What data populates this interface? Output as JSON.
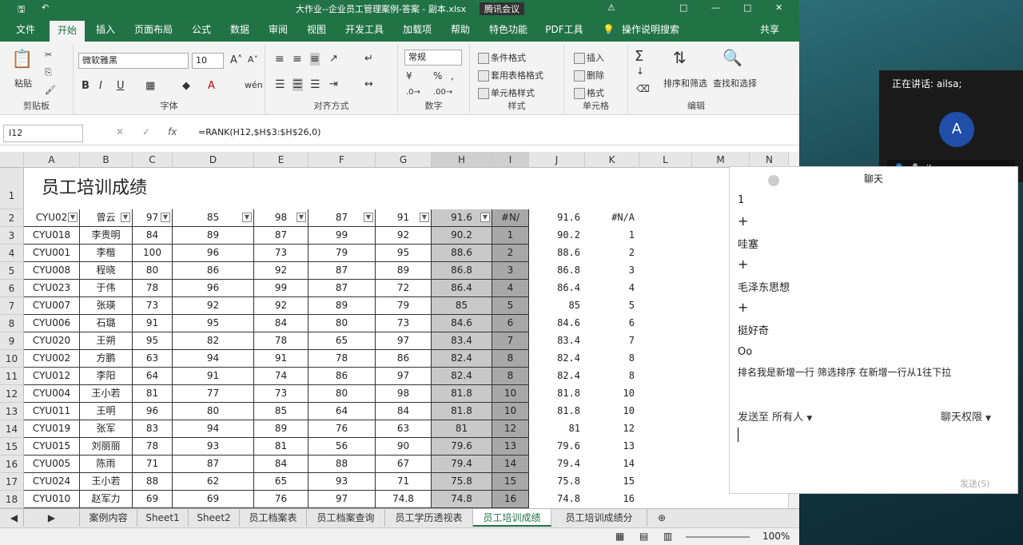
{
  "titlebar": {
    "title": "大作业--企业员工管理案例-答案 - 副本.xlsx",
    "meeting": "腾讯会议"
  },
  "ribbon_tabs": [
    "文件",
    "开始",
    "插入",
    "页面布局",
    "公式",
    "数据",
    "审阅",
    "视图",
    "开发工具",
    "加载项",
    "帮助",
    "特色功能",
    "PDF工具",
    "操作说明搜索",
    "共享"
  ],
  "ribbon": {
    "clipboard": {
      "paste": "粘贴",
      "label": "剪贴板"
    },
    "font": {
      "name": "微软雅黑",
      "size": "10",
      "label": "字体"
    },
    "align": {
      "label": "对齐方式"
    },
    "number": {
      "format": "常规",
      "label": "数字"
    },
    "styles": {
      "cond": "条件格式",
      "table": "套用表格格式",
      "cell": "单元格样式",
      "label": "样式"
    },
    "cells": {
      "insert": "插入",
      "delete": "删除",
      "format": "格式",
      "label": "单元格"
    },
    "editing": {
      "sort": "排序和筛选",
      "find": "查找和选择",
      "label": "编辑"
    }
  },
  "formula_bar": {
    "name_box": "I12",
    "formula": "=RANK(H12,$H$3:$H$26,0)"
  },
  "columns": [
    "A",
    "B",
    "C",
    "D",
    "E",
    "F",
    "G",
    "H",
    "I",
    "J",
    "K",
    "L",
    "M",
    "N"
  ],
  "sheet_title": "员工培训成绩",
  "header_row": [
    "CYU02",
    "曾云",
    "97",
    "85",
    "98",
    "87",
    "91",
    "91.6",
    "#N/"
  ],
  "header_extra": [
    "91.6",
    "#N/A"
  ],
  "rows": [
    [
      "3",
      "CYU018",
      "李贵明",
      "84",
      "89",
      "87",
      "99",
      "92",
      "90.2",
      "1",
      "90.2",
      "1"
    ],
    [
      "4",
      "CYU001",
      "李楷",
      "100",
      "96",
      "73",
      "79",
      "95",
      "88.6",
      "2",
      "88.6",
      "2"
    ],
    [
      "5",
      "CYU008",
      "程晓",
      "80",
      "86",
      "92",
      "87",
      "89",
      "86.8",
      "3",
      "86.8",
      "3"
    ],
    [
      "6",
      "CYU023",
      "于伟",
      "78",
      "96",
      "99",
      "87",
      "72",
      "86.4",
      "4",
      "86.4",
      "4"
    ],
    [
      "7",
      "CYU007",
      "张瑛",
      "73",
      "92",
      "92",
      "89",
      "79",
      "85",
      "5",
      "85",
      "5"
    ],
    [
      "8",
      "CYU006",
      "石璐",
      "91",
      "95",
      "84",
      "80",
      "73",
      "84.6",
      "6",
      "84.6",
      "6"
    ],
    [
      "9",
      "CYU020",
      "王朔",
      "95",
      "82",
      "78",
      "65",
      "97",
      "83.4",
      "7",
      "83.4",
      "7"
    ],
    [
      "10",
      "CYU002",
      "方鹏",
      "63",
      "94",
      "91",
      "78",
      "86",
      "82.4",
      "8",
      "82.4",
      "8"
    ],
    [
      "11",
      "CYU012",
      "李阳",
      "64",
      "91",
      "74",
      "86",
      "97",
      "82.4",
      "8",
      "82.4",
      "8"
    ],
    [
      "12",
      "CYU004",
      "王小若",
      "81",
      "77",
      "73",
      "80",
      "98",
      "81.8",
      "10",
      "81.8",
      "10"
    ],
    [
      "13",
      "CYU011",
      "王明",
      "96",
      "80",
      "85",
      "64",
      "84",
      "81.8",
      "10",
      "81.8",
      "10"
    ],
    [
      "14",
      "CYU019",
      "张军",
      "83",
      "94",
      "89",
      "76",
      "63",
      "81",
      "12",
      "81",
      "12"
    ],
    [
      "15",
      "CYU015",
      "刘丽丽",
      "78",
      "93",
      "81",
      "56",
      "90",
      "79.6",
      "13",
      "79.6",
      "13"
    ],
    [
      "16",
      "CYU005",
      "陈雨",
      "71",
      "87",
      "84",
      "88",
      "67",
      "79.4",
      "14",
      "79.4",
      "14"
    ],
    [
      "17",
      "CYU024",
      "王小若",
      "88",
      "62",
      "65",
      "93",
      "71",
      "75.8",
      "15",
      "75.8",
      "15"
    ],
    [
      "18",
      "CYU010",
      "赵军力",
      "69",
      "69",
      "76",
      "97",
      "74.8",
      "74.8",
      "16",
      "74.8",
      "16"
    ]
  ],
  "sheet_tabs": [
    "案例内容",
    "Sheet1",
    "Sheet2",
    "员工档案表",
    "员工档案查询",
    "员工学历透视表",
    "员工培训成绩",
    "员工培训成绩分"
  ],
  "status": {
    "zoom": "100%"
  },
  "chat": {
    "header": "聊天",
    "messages": [
      "1",
      "+",
      "哇塞",
      "+",
      "毛泽东思想",
      "+",
      "挺好奇",
      "Oo",
      "排名我是新增一行   筛选排序   在新增一行从1往下拉"
    ],
    "send_to_label": "发送至",
    "send_to_value": "所有人",
    "permission": "聊天权限",
    "send_button": "发送(S)"
  },
  "meeting": {
    "speaking": "正在讲话: ailsa;",
    "avatar_letter": "A",
    "user": "ailsa"
  }
}
